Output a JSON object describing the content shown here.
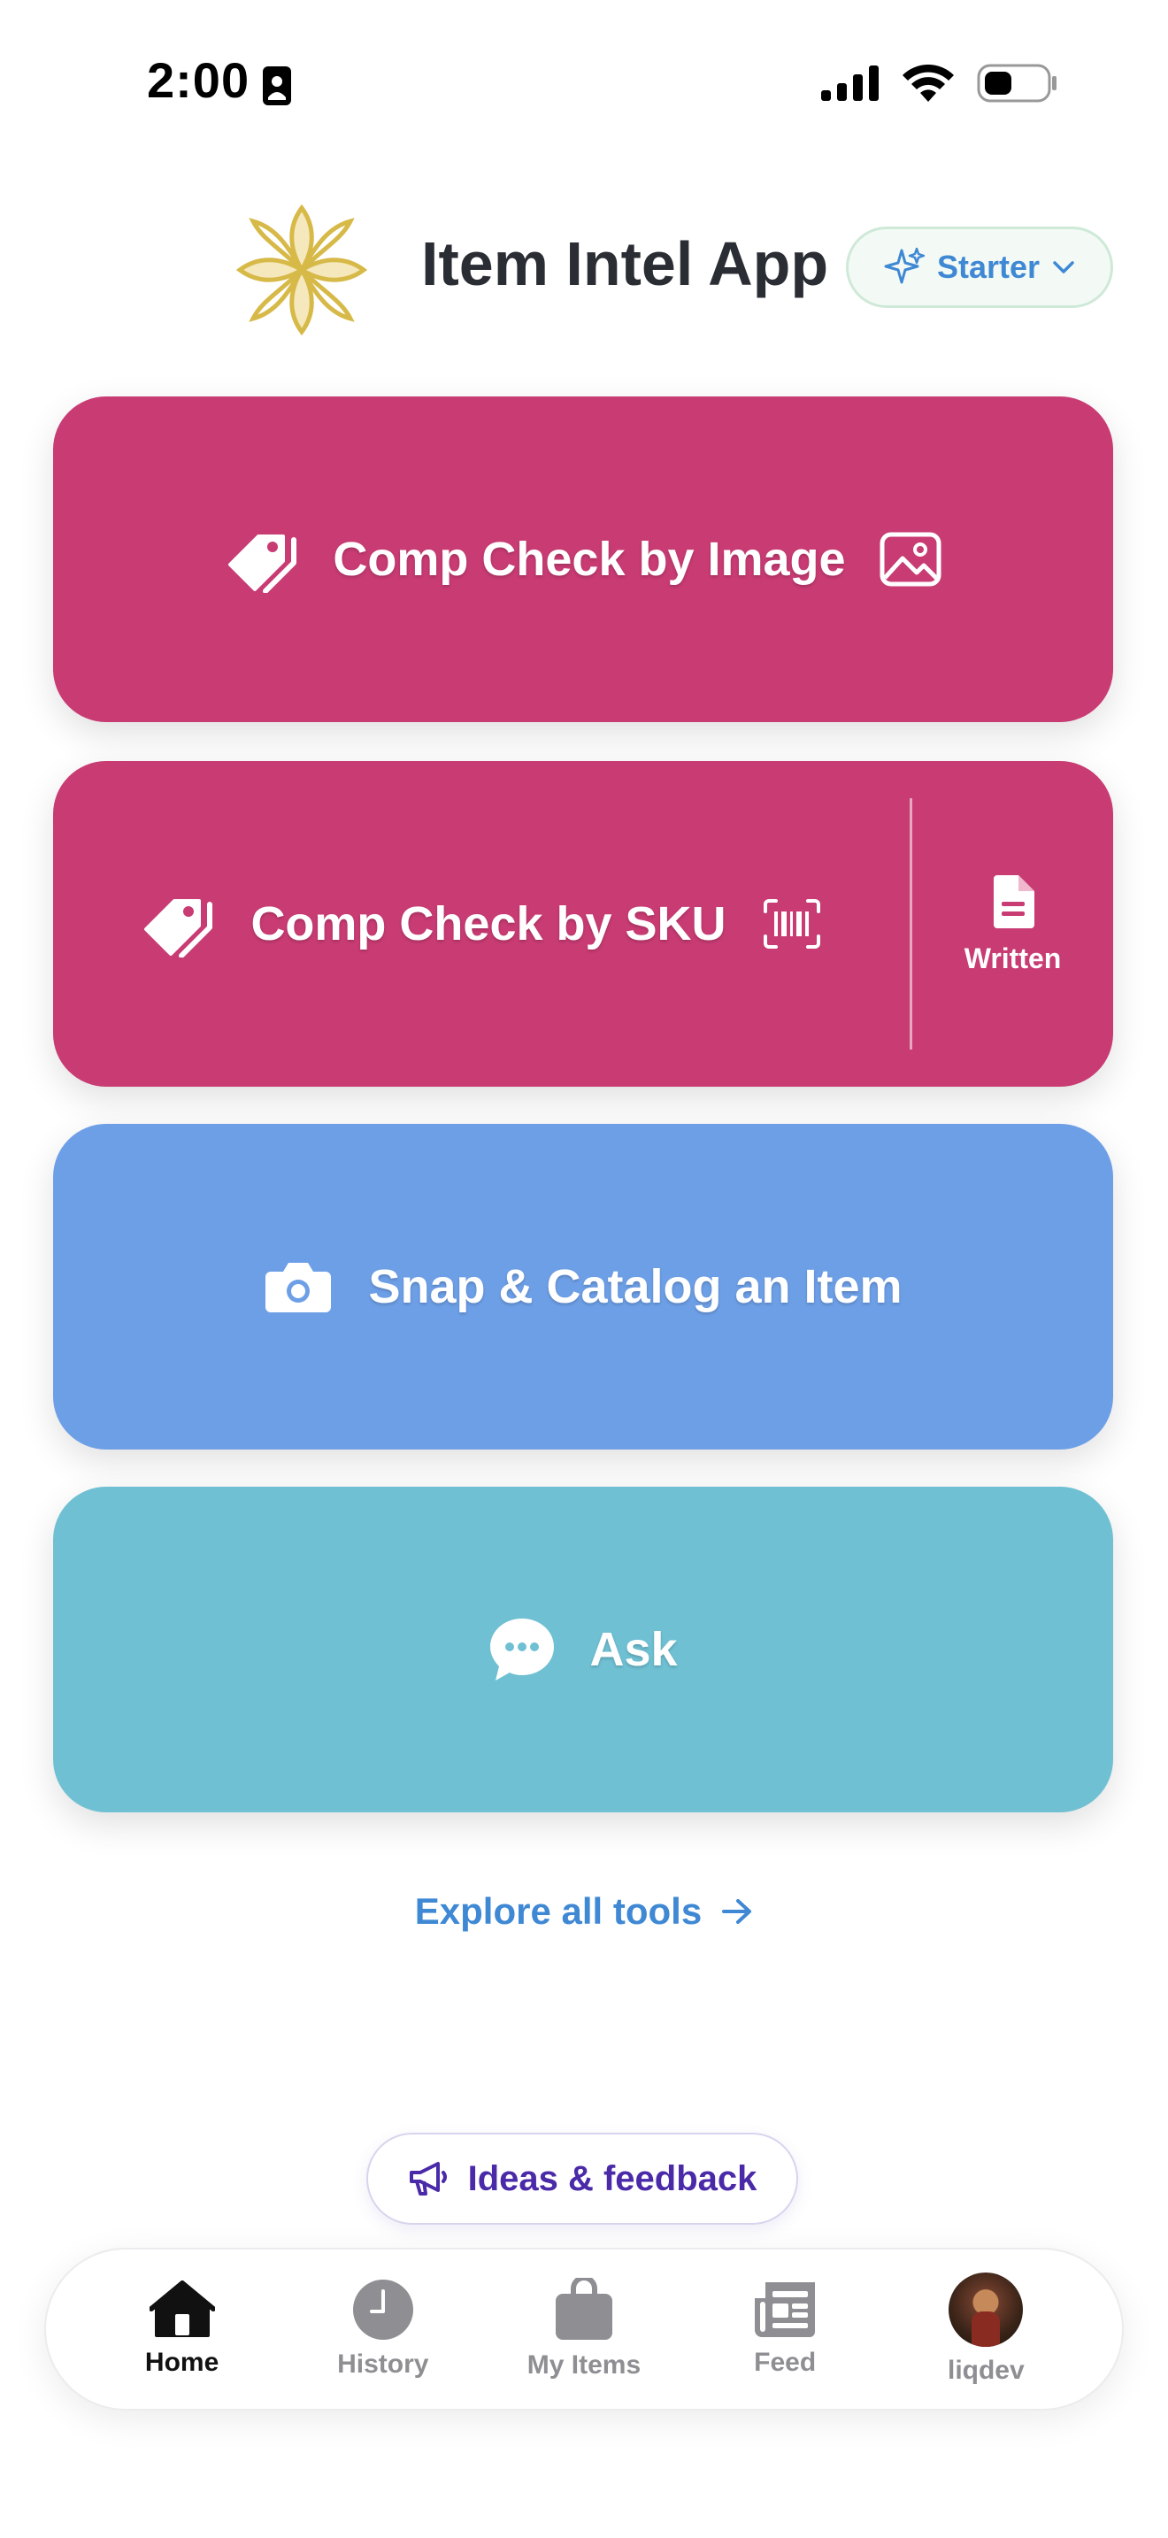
{
  "status_bar": {
    "time": "2:00",
    "icons": [
      "contact-card-icon",
      "cellular-signal-icon",
      "wifi-icon",
      "battery-icon"
    ]
  },
  "header": {
    "app_title": "Item Intel App",
    "logo_icon": "gold-flourish-logo",
    "plan": {
      "label": "Starter",
      "icon": "sparkle-icon",
      "chevron": "chevron-down-icon"
    }
  },
  "actions": {
    "comp_image": {
      "label": "Comp Check by Image",
      "left_icon": "tag-icon",
      "right_icon": "image-icon"
    },
    "comp_sku": {
      "label": "Comp Check by SKU",
      "left_icon": "tag-icon",
      "right_icon": "barcode-icon",
      "side_label": "Written",
      "side_icon": "document-icon"
    },
    "snap": {
      "label": "Snap & Catalog an Item",
      "icon": "camera-icon"
    },
    "ask": {
      "label": "Ask",
      "icon": "chat-bubble-icon"
    }
  },
  "explore": {
    "label": "Explore all tools",
    "icon": "arrow-right-icon"
  },
  "feedback": {
    "label": "Ideas & feedback",
    "icon": "megaphone-icon"
  },
  "tabbar": {
    "tabs": [
      {
        "label": "Home",
        "icon": "home-icon",
        "active": true
      },
      {
        "label": "History",
        "icon": "clock-icon",
        "active": false
      },
      {
        "label": "My Items",
        "icon": "bag-icon",
        "active": false
      },
      {
        "label": "Feed",
        "icon": "newspaper-icon",
        "active": false
      },
      {
        "label": "liqdev",
        "icon": "avatar",
        "active": false
      }
    ]
  },
  "colors": {
    "comp_card": "#c83b73",
    "snap_card": "#6d9fe7",
    "ask_card": "#6fc0d3",
    "link_blue": "#3f88d4",
    "feedback_purple": "#4a2aa8"
  }
}
